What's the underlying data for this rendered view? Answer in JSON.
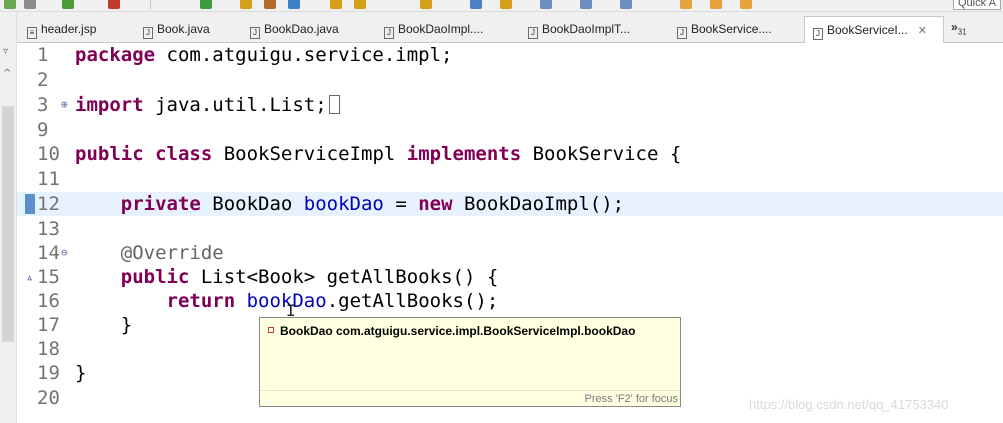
{
  "toolbar": {
    "quick_access": "Quick A"
  },
  "tabs": [
    {
      "label": "header.jsp",
      "icon": "jsp-file-icon"
    },
    {
      "label": "Book.java",
      "icon": "java-file-icon"
    },
    {
      "label": "BookDao.java",
      "icon": "java-file-icon"
    },
    {
      "label": "BookDaoImpl....",
      "icon": "java-file-icon"
    },
    {
      "label": "BookDaoImplT...",
      "icon": "java-file-icon"
    },
    {
      "label": "BookService....",
      "icon": "java-file-icon"
    },
    {
      "label": "BookServiceI...",
      "icon": "java-file-icon",
      "active": true
    }
  ],
  "tab_close": "✕",
  "tab_overflow": {
    "chevron": "»",
    "count": "31"
  },
  "editor": {
    "lines": [
      {
        "num": "1",
        "tokens": [
          {
            "t": "package",
            "c": "kw"
          },
          {
            "t": " com.atguigu.service.impl;"
          }
        ]
      },
      {
        "num": "2",
        "tokens": []
      },
      {
        "num": "3",
        "fold": "⊕",
        "tokens": [
          {
            "t": "import",
            "c": "kw"
          },
          {
            "t": " java.util.List;"
          }
        ],
        "collapsed_box": true
      },
      {
        "num": "9",
        "tokens": []
      },
      {
        "num": "10",
        "tokens": [
          {
            "t": "public",
            "c": "kw"
          },
          {
            "t": " "
          },
          {
            "t": "class",
            "c": "kw"
          },
          {
            "t": " BookServiceImpl "
          },
          {
            "t": "implements",
            "c": "kw"
          },
          {
            "t": " BookService {"
          }
        ]
      },
      {
        "num": "11",
        "tokens": []
      },
      {
        "num": "12",
        "current": true,
        "tokens": [
          {
            "t": "    "
          },
          {
            "t": "private",
            "c": "kw"
          },
          {
            "t": " BookDao "
          },
          {
            "t": "bookDao",
            "c": "field"
          },
          {
            "t": " = "
          },
          {
            "t": "new",
            "c": "kw"
          },
          {
            "t": " BookDaoImpl();"
          }
        ]
      },
      {
        "num": "13",
        "tokens": []
      },
      {
        "num": "14",
        "fold": "⊖",
        "tokens": [
          {
            "t": "    "
          },
          {
            "t": "@Override",
            "c": "ann"
          }
        ]
      },
      {
        "num": "15",
        "override_mark": "▵",
        "tokens": [
          {
            "t": "    "
          },
          {
            "t": "public",
            "c": "kw"
          },
          {
            "t": " List<Book> getAllBooks() {"
          }
        ]
      },
      {
        "num": "16",
        "tokens": [
          {
            "t": "        "
          },
          {
            "t": "return",
            "c": "kw"
          },
          {
            "t": " "
          },
          {
            "t": "bookDao",
            "c": "field"
          },
          {
            "t": ".getAllBooks();"
          }
        ]
      },
      {
        "num": "17",
        "tokens": [
          {
            "t": "    }"
          }
        ]
      },
      {
        "num": "18",
        "tokens": []
      },
      {
        "num": "19",
        "tokens": [
          {
            "t": "}"
          }
        ]
      },
      {
        "num": "20",
        "tokens": []
      }
    ]
  },
  "hover": {
    "text": "BookDao com.atguigu.service.impl.BookServiceImpl.bookDao",
    "footer": "Press 'F2' for focus"
  },
  "watermark": "https://blog.csdn.net/qq_41753340",
  "colors": {
    "keyword": "#7f0055",
    "field": "#0000c0",
    "annotation": "#646464",
    "line_number": "#737373",
    "current_line": "#e8f2fe",
    "tooltip_bg": "#ffffe1"
  }
}
